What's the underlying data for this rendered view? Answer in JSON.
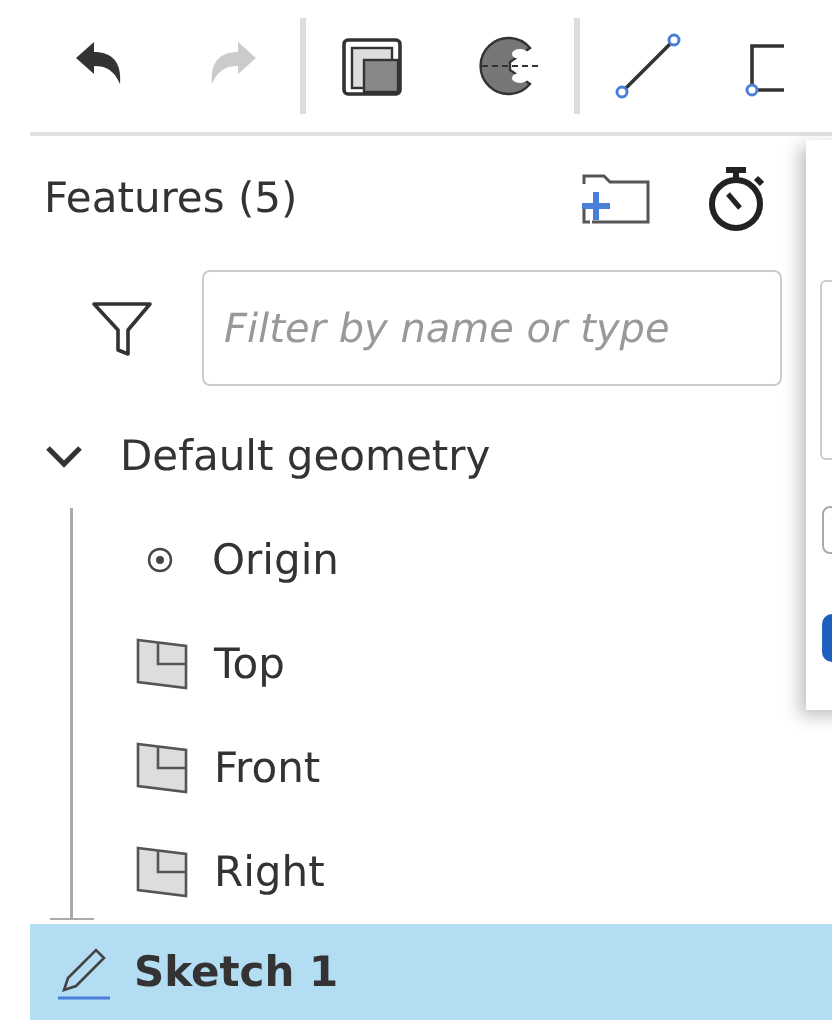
{
  "toolbar": {
    "groups": [
      [
        {
          "kind": "undo",
          "disabled": false
        },
        {
          "kind": "redo",
          "disabled": true
        }
      ],
      [
        {
          "kind": "extrude",
          "disabled": false
        },
        {
          "kind": "revolve",
          "disabled": false
        }
      ],
      [
        {
          "kind": "line",
          "disabled": false
        },
        {
          "kind": "rectangle",
          "disabled": false
        }
      ]
    ]
  },
  "features_panel": {
    "title": "Features (5)",
    "filter": {
      "placeholder": "Filter by name or type"
    },
    "tree": [
      {
        "label": "Default geometry",
        "kind": "folder",
        "expanded": true,
        "selected": false,
        "children": [
          {
            "label": "Origin",
            "kind": "point",
            "selected": false
          },
          {
            "label": "Top",
            "kind": "plane",
            "selected": false
          },
          {
            "label": "Front",
            "kind": "plane",
            "selected": false
          },
          {
            "label": "Right",
            "kind": "plane",
            "selected": false
          }
        ]
      },
      {
        "label": "Sketch 1",
        "kind": "sketch",
        "selected": true
      }
    ]
  },
  "side_dialog": {
    "checkbox_checked": false
  }
}
